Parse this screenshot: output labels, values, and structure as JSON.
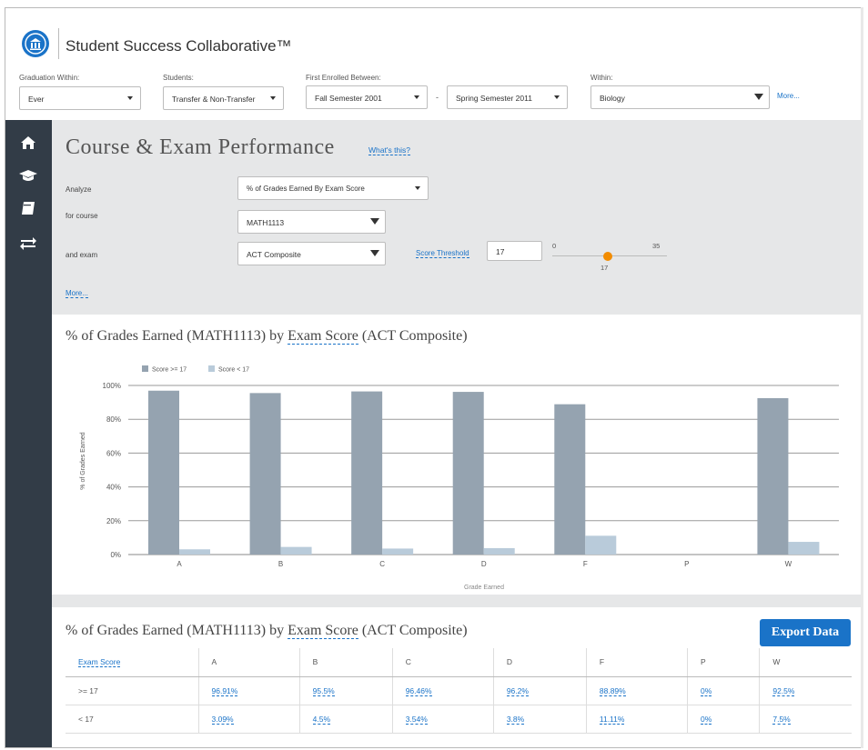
{
  "header": {
    "brand": "Student Success Collaborative™"
  },
  "filters": {
    "graduation": {
      "label": "Graduation Within:",
      "value": "Ever"
    },
    "students": {
      "label": "Students:",
      "value": "Transfer & Non-Transfer"
    },
    "enrolled": {
      "label": "First Enrolled Between:",
      "from": "Fall Semester 2001",
      "separator": "-",
      "to": "Spring Semester 2011"
    },
    "within": {
      "label": "Within:",
      "value": "Biology"
    },
    "more_link": "More..."
  },
  "sidebar": {
    "icons": [
      "home-icon",
      "graduation-cap-icon",
      "book-icon",
      "swap-arrows-icon"
    ]
  },
  "page": {
    "title": "Course & Exam Performance",
    "whats_this": "What's this?"
  },
  "controls": {
    "analyze_label": "Analyze",
    "analyze_value": "% of Grades Earned By Exam Score",
    "course_label": "for course",
    "course_value": "MATH1113",
    "exam_label": "and exam",
    "exam_value": "ACT Composite",
    "threshold_label": "Score Threshold",
    "threshold_value": "17",
    "slider_min": "0",
    "slider_max": "35",
    "slider_current": "17",
    "slider_fraction": 0.486,
    "more_link": "More..."
  },
  "chart": {
    "title_prefix": "% of Grades Earned (MATH1113) by ",
    "title_link": "Exam Score",
    "title_suffix": " (ACT Composite)"
  },
  "chart_data": {
    "type": "bar",
    "categories": [
      "A",
      "B",
      "C",
      "D",
      "F",
      "P",
      "W"
    ],
    "series": [
      {
        "name": "Score >= 17",
        "values": [
          96.91,
          95.5,
          96.46,
          96.2,
          88.89,
          0,
          92.5
        ],
        "color": "#95a3b0"
      },
      {
        "name": "Score < 17",
        "values": [
          3.09,
          4.5,
          3.54,
          3.8,
          11.11,
          0,
          7.5
        ],
        "color": "#b9cbda"
      }
    ],
    "yticks": [
      "0%",
      "20%",
      "40%",
      "60%",
      "80%",
      "100%"
    ],
    "ylim": [
      0,
      100
    ],
    "ylabel": "% of Grades Earned",
    "xlabel": "Grade Earned",
    "legend": "top-left",
    "grid": true
  },
  "table": {
    "title_prefix": "% of Grades Earned (MATH1113) by ",
    "title_link": "Exam Score",
    "title_suffix": " (ACT Composite)",
    "export_label": "Export Data",
    "header": [
      "Exam Score",
      "A",
      "B",
      "C",
      "D",
      "F",
      "P",
      "W"
    ],
    "rows": [
      {
        "label": ">= 17",
        "cells": [
          "96.91%",
          "95.5%",
          "96.46%",
          "96.2%",
          "88.89%",
          "0%",
          "92.5%"
        ]
      },
      {
        "label": "< 17",
        "cells": [
          "3.09%",
          "4.5%",
          "3.54%",
          "3.8%",
          "11.11%",
          "0%",
          "7.5%"
        ]
      }
    ]
  }
}
